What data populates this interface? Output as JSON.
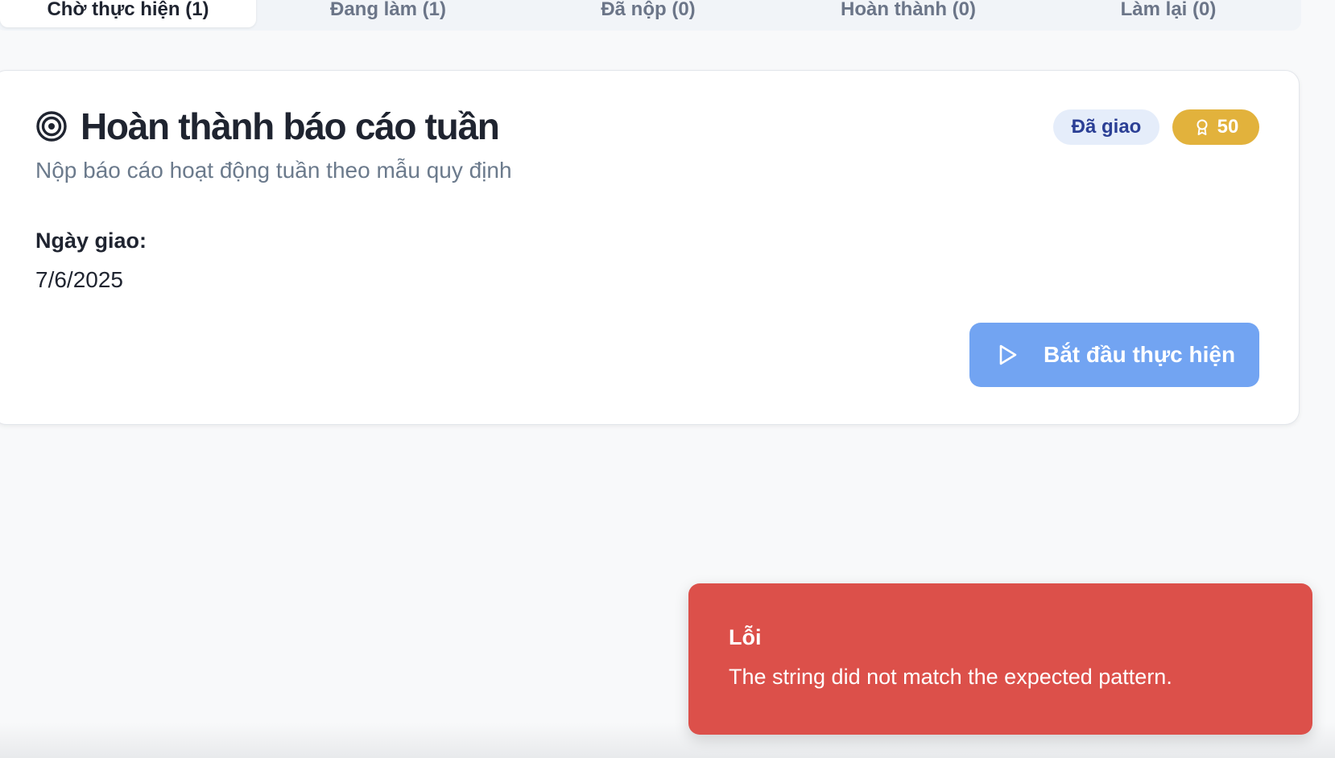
{
  "tabs": [
    {
      "label": "Chờ thực hiện (1)",
      "active": true
    },
    {
      "label": "Đang làm (1)",
      "active": false
    },
    {
      "label": "Đã nộp (0)",
      "active": false
    },
    {
      "label": "Hoàn thành (0)",
      "active": false
    },
    {
      "label": "Làm lại (0)",
      "active": false
    }
  ],
  "task": {
    "icon": "target-icon",
    "title": "Hoàn thành báo cáo tuần",
    "description": "Nộp báo cáo hoạt động tuần theo mẫu quy định",
    "status_badge": "Đã giao",
    "points_icon": "medal-icon",
    "points": "50",
    "date_label": "Ngày giao:",
    "date_value": "7/6/2025",
    "start_button_icon": "play-icon",
    "start_button_label": "Bắt đầu thực hiện"
  },
  "toast": {
    "title": "Lỗi",
    "message": "The string did not match the expected pattern."
  },
  "colors": {
    "status_badge_bg": "#e5edfa",
    "status_badge_text": "#2b3f95",
    "points_badge_bg": "#e2b23c",
    "start_button_bg": "#72a4f2",
    "toast_bg": "#dc504a"
  }
}
